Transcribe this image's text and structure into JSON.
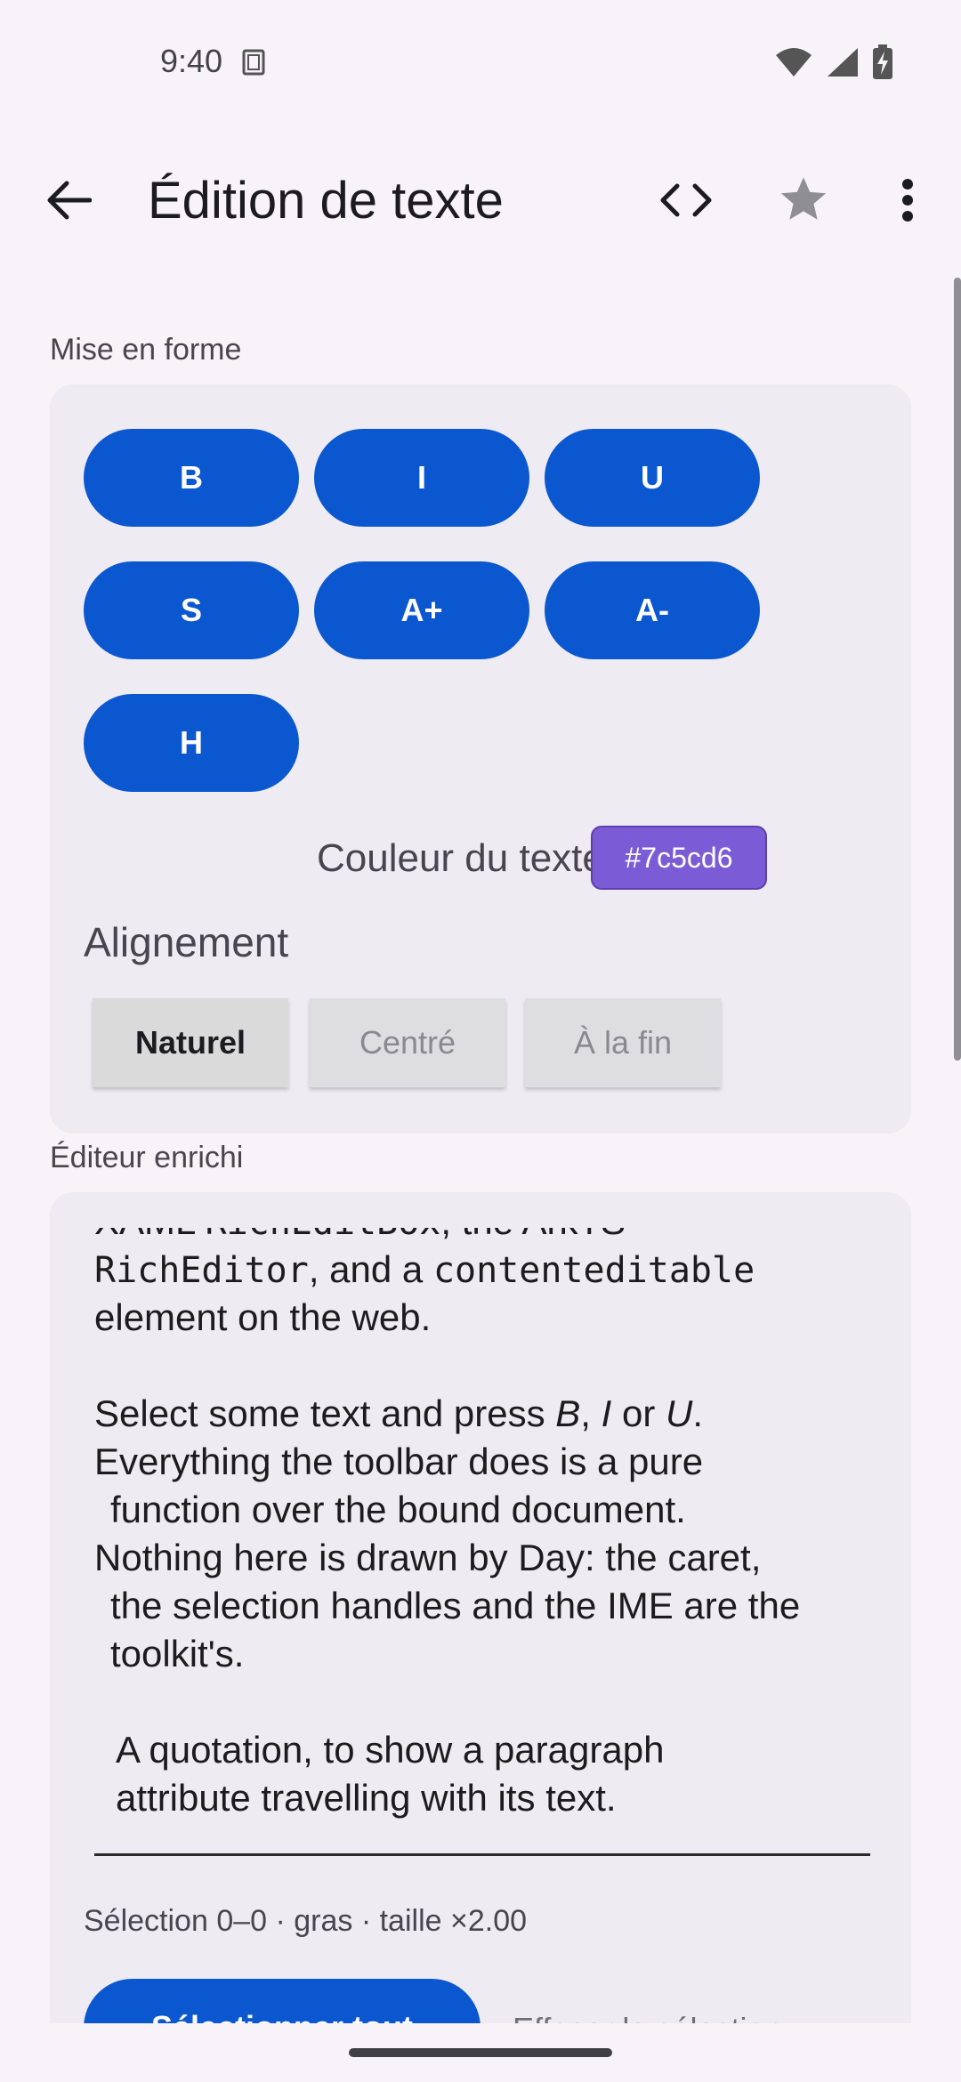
{
  "status": {
    "time": "9:40",
    "icons": [
      "sim-card-icon",
      "wifi-icon",
      "signal-icon",
      "battery-charging-icon"
    ]
  },
  "app_bar": {
    "title": "Édition de texte",
    "icons": [
      "back-arrow-icon",
      "code-icon",
      "star-icon",
      "more-vert-icon"
    ]
  },
  "format_section": {
    "label": "Mise en forme",
    "buttons": [
      "B",
      "I",
      "U",
      "S",
      "A+",
      "A-",
      "H"
    ],
    "color_label": "Couleur du texte",
    "color_value": "#7c5cd6",
    "alignment_label": "Alignement",
    "alignment_options": [
      "Naturel",
      "Centré",
      "À la fin"
    ],
    "alignment_selected": "Naturel"
  },
  "editor_section": {
    "label": "Éditeur enrichi",
    "lines": {
      "l1_a": "XAML ",
      "l1_b": "RichEditBox",
      "l1_c": ", the ArkTS",
      "l2_a": "RichEditor",
      "l2_b": ", and a ",
      "l2_c": "contenteditable",
      "l3": "element on the web.",
      "l4_a": "Select some text and press ",
      "l4_b": "B",
      "l4_c": ", ",
      "l4_d": "I",
      "l4_e": " or ",
      "l4_f": "U",
      "l4_g": ".",
      "l5": "Everything the toolbar does is a pure",
      "l6": "function over the bound document.",
      "l7": "Nothing here is drawn by Day: the caret,",
      "l8": "the selection handles and the IME are the",
      "l9": "toolkit's.",
      "l10": "A quotation, to show a paragraph",
      "l11": "attribute travelling with its text."
    },
    "selection_info": "Sélection 0–0 · gras · taille ×2.00",
    "select_all_label": "Sélectionner tout",
    "clear_selection_label": "Effacer la sélection"
  },
  "colors": {
    "primary": "#0b57d0",
    "text_color_chip": "#7c5cd6",
    "background": "#f7f3f9",
    "card": "#eeebf2"
  }
}
